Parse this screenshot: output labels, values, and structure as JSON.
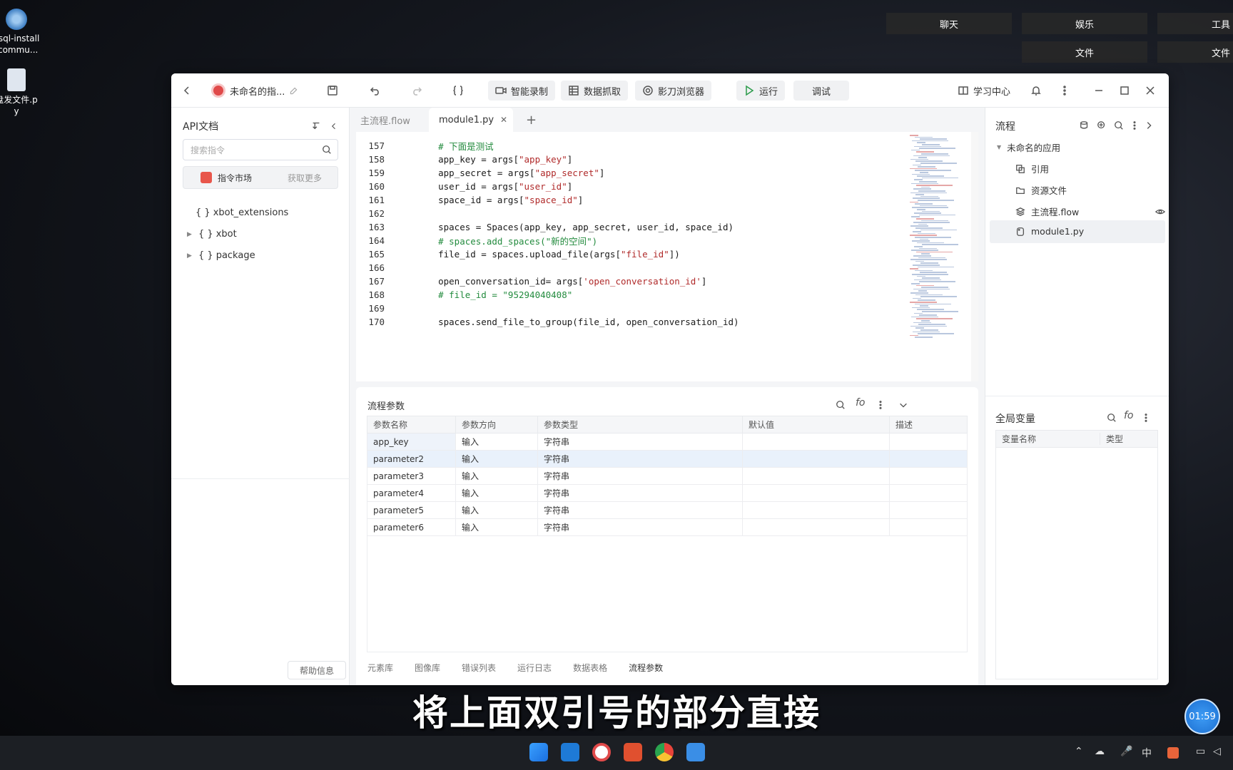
{
  "desktop": {
    "icons": [
      {
        "label": "ysql-install\n-commu..."
      },
      {
        "label": "盘发文件.p\ny"
      }
    ],
    "top_menu": [
      "聊天",
      "娱乐",
      "工具",
      "文件",
      "文件"
    ]
  },
  "window": {
    "app_name": "未命名的指...",
    "toolbar": {
      "smart_record": "智能录制",
      "data_capture": "数据抓取",
      "browser": "影刀浏览器",
      "run": "运行",
      "debug": "调试",
      "learning_center": "学习中心"
    },
    "left_panel": {
      "title": "API文档",
      "search_placeholder": "搜索指令",
      "market_label": "指令市场",
      "get_more": "获取更多",
      "tree": [
        "xbot_extensions",
        "xbot",
        "package"
      ],
      "help": "帮助信息"
    },
    "tabs": [
      "主流程.flow",
      "module1.py"
    ],
    "code_lines": [
      {
        "n": "157",
        "text": "    # 下面是测试",
        "kind": "comment"
      },
      {
        "n": "158",
        "pre": "    app_key = args[",
        "str": "\"app_key\"",
        "post": "]"
      },
      {
        "n": "159",
        "pre": "    app_secret = args[",
        "str": "\"app_secret\"",
        "post": "]"
      },
      {
        "n": "160",
        "pre": "    user_id = args[",
        "str": "\"user_id\"",
        "post": "]"
      },
      {
        "n": "161",
        "pre": "    space_id = args[",
        "str": "\"space_id\"",
        "post": "]"
      },
      {
        "n": "162",
        "text": ""
      },
      {
        "n": "163",
        "text": "    spaces = Spaces(app_key, app_secret, user_id, space_id)"
      },
      {
        "n": "164",
        "text": "    # spaces.add_spaces(\"新的空间\")",
        "kind": "comment"
      },
      {
        "n": "165",
        "pre": "    file_id = spaces.upload_file(args[",
        "str": "\"file_id\"",
        "post": "])"
      },
      {
        "n": "166",
        "text": ""
      },
      {
        "n": "167",
        "pre": "    open_conversation_id= args[",
        "str": "'open_conversation_id'",
        "post": "]"
      },
      {
        "n": "168",
        "text": "    # file_id = \"95294040408\"",
        "kind": "comment"
      },
      {
        "n": "169",
        "text": ""
      },
      {
        "n": "170",
        "text": "    spaces.send_file_to_group(file_id, open_conversation_id)"
      }
    ],
    "params_panel": {
      "title": "流程参数",
      "headers": [
        "参数名称",
        "参数方向",
        "参数类型",
        "默认值",
        "描述"
      ],
      "rows": [
        [
          "app_key",
          "输入",
          "字符串",
          "",
          ""
        ],
        [
          "parameter2",
          "输入",
          "字符串",
          "",
          ""
        ],
        [
          "parameter3",
          "输入",
          "字符串",
          "",
          ""
        ],
        [
          "parameter4",
          "输入",
          "字符串",
          "",
          ""
        ],
        [
          "parameter5",
          "输入",
          "字符串",
          "",
          ""
        ],
        [
          "parameter6",
          "输入",
          "字符串",
          "",
          ""
        ]
      ],
      "bottom_tabs": [
        "元素库",
        "图像库",
        "错误列表",
        "运行日志",
        "数据表格",
        "流程参数"
      ]
    },
    "right_panel": {
      "title": "流程",
      "app_name": "未命名的应用",
      "items": [
        "引用",
        "资源文件",
        "主流程.flow",
        "module1.py"
      ],
      "vars_title": "全局变量",
      "var_headers": [
        "变量名称",
        "类型"
      ]
    }
  },
  "subtitle": "将上面双引号的部分直接",
  "timer": "01:59",
  "tray": {
    "ime": "中"
  }
}
